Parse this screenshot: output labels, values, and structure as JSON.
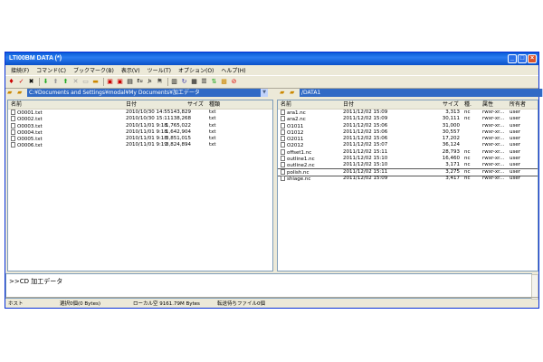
{
  "window": {
    "title": "LTI00BM DATA (*)"
  },
  "menu": [
    "接続(F)",
    "コマンド(C)",
    "ブックマーク(B)",
    "表示(V)",
    "ツール(T)",
    "オプション(O)",
    "ヘルプ(H)"
  ],
  "left": {
    "path": "C:¥Documents and Settings¥modal¥My Documents¥加工データ",
    "headers": {
      "name": "名前",
      "date": "日付",
      "size": "サイズ",
      "type": "種類"
    },
    "files": [
      {
        "name": "O0001.txt",
        "date": "2010/10/30 14:55",
        "size": "143,829",
        "type": "txt"
      },
      {
        "name": "O0002.txt",
        "date": "2010/10/30 15:11",
        "size": "138,268",
        "type": "txt"
      },
      {
        "name": "O0003.txt",
        "date": "2010/11/01 9:18",
        "size": "1,765,022",
        "type": "txt"
      },
      {
        "name": "O0004.txt",
        "date": "2010/11/01 9:18",
        "size": "1,642,904",
        "type": "txt"
      },
      {
        "name": "O0005.txt",
        "date": "2010/11/01 9:18",
        "size": "3,851,015",
        "type": "txt"
      },
      {
        "name": "O0006.txt",
        "date": "2010/11/01 9:19",
        "size": "3,824,894",
        "type": "txt"
      }
    ]
  },
  "right": {
    "path": "/DATA1",
    "headers": {
      "name": "名前",
      "date": "日付",
      "size": "サイズ",
      "type": "種.",
      "attr": "属性",
      "owner": "所有者"
    },
    "files": [
      {
        "name": "ara1.nc",
        "date": "2011/12/02 15:09",
        "size": "3,313",
        "type": "nc",
        "attr": "rwxr-xr...",
        "owner": "user"
      },
      {
        "name": "ara2.nc",
        "date": "2011/12/02 15:09",
        "size": "30,111",
        "type": "nc",
        "attr": "rwxr-xr...",
        "owner": "user"
      },
      {
        "name": "O1011",
        "date": "2011/12/02 15:06",
        "size": "31,000",
        "type": "",
        "attr": "rwxr-xr...",
        "owner": "user"
      },
      {
        "name": "O1012",
        "date": "2011/12/02 15:06",
        "size": "30,557",
        "type": "",
        "attr": "rwxr-xr...",
        "owner": "user"
      },
      {
        "name": "O2011",
        "date": "2011/12/02 15:06",
        "size": "17,202",
        "type": "",
        "attr": "rwxr-xr...",
        "owner": "user"
      },
      {
        "name": "O2012",
        "date": "2011/12/02 15:07",
        "size": "36,124",
        "type": "",
        "attr": "rwxr-xr...",
        "owner": "user"
      },
      {
        "name": "offset1.nc",
        "date": "2011/12/02 15:11",
        "size": "28,793",
        "type": "nc",
        "attr": "rwxr-xr...",
        "owner": "user"
      },
      {
        "name": "outline1.nc",
        "date": "2011/12/02 15:10",
        "size": "16,460",
        "type": "nc",
        "attr": "rwxr-xr...",
        "owner": "user"
      },
      {
        "name": "outline2.nc",
        "date": "2011/12/02 15:10",
        "size": "3,171",
        "type": "nc",
        "attr": "rwxr-xr...",
        "owner": "user"
      },
      {
        "name": "polish.nc",
        "date": "2011/12/02 15:11",
        "size": "3,275",
        "type": "nc",
        "attr": "rwxr-xr...",
        "owner": "user"
      },
      {
        "name": "shiage.nc",
        "date": "2011/12/02 15:09",
        "size": "3,417",
        "type": "nc",
        "attr": "rwxr-xr...",
        "owner": "user"
      }
    ]
  },
  "command_log": ">>CD 加工データ",
  "status": {
    "host": "ホスト",
    "selection": "選択0個(0 Bytes)",
    "local_free": "ローカル空 9161.79M Bytes",
    "queue": "転送待ちファイル0個"
  }
}
